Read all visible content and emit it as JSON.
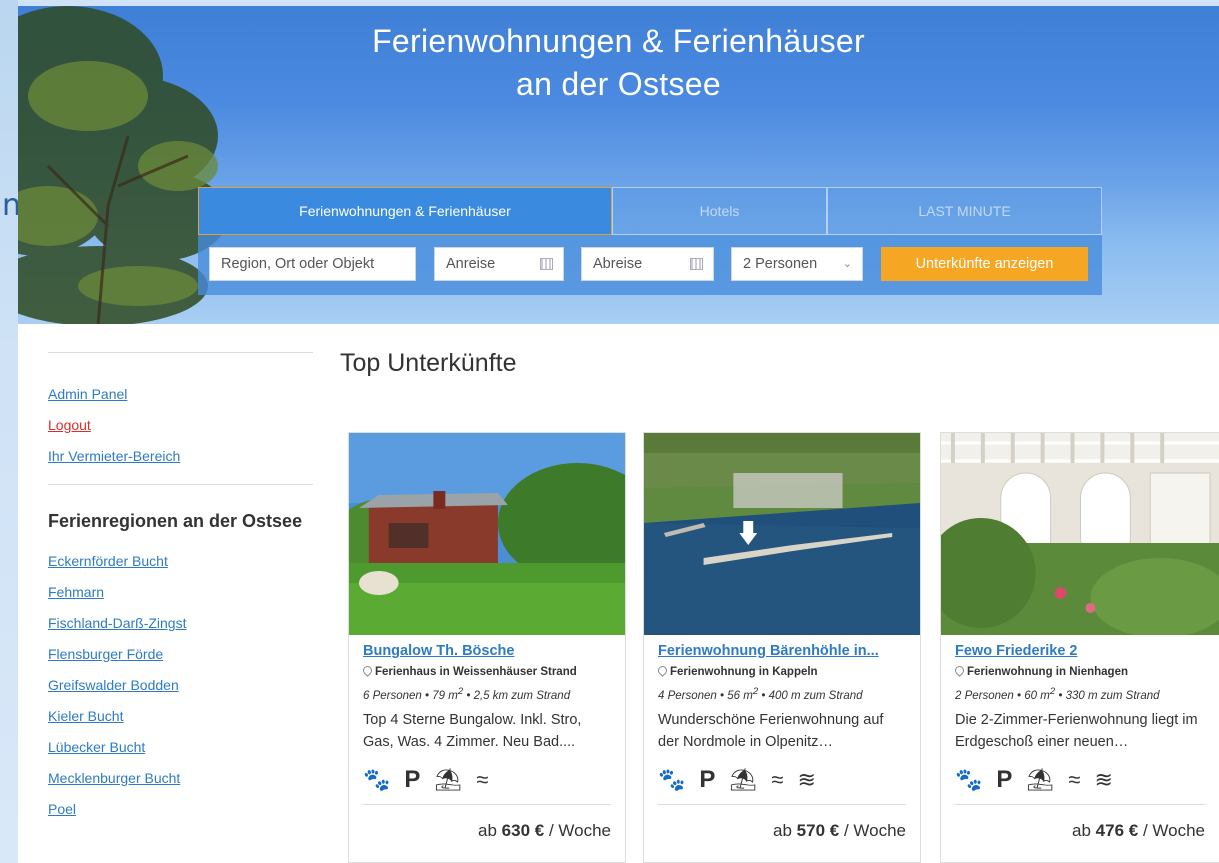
{
  "hero": {
    "title_line1": "Ferienwohnungen & Ferienhäuser",
    "title_line2": "an der Ostsee"
  },
  "search": {
    "tabs": [
      {
        "label": "Ferienwohnungen & Ferienhäuser",
        "active": true
      },
      {
        "label": "Hotels",
        "active": false
      },
      {
        "label": "LAST MINUTE",
        "active": false
      }
    ],
    "region_placeholder": "Region, Ort oder Objekt",
    "anreise_placeholder": "Anreise",
    "abreise_placeholder": "Abreise",
    "persons_value": "2 Personen",
    "submit_label": "Unterkünfte anzeigen"
  },
  "sidebar": {
    "links": [
      "Admin Panel",
      "Logout",
      "Ihr Vermieter-Bereich"
    ],
    "regions_heading": "Ferienregionen an der Ostsee",
    "regions": [
      "Eckernförder Bucht",
      "Fehmarn",
      "Fischland-Darß-Zingst",
      "Flensburger Förde",
      "Greifswalder Bodden",
      "Kieler Bucht",
      "Lübecker Bucht",
      "Mecklenburger Bucht",
      "Poel"
    ]
  },
  "main": {
    "title": "Top Unterkünfte",
    "cards": [
      {
        "name": "Bungalow Th. Bösche",
        "location": "Ferienhaus in Weissenhäuser Strand",
        "persons": "6 Personen",
        "area": "79",
        "distance": "2,5 km zum Strand",
        "description": "Top 4 Sterne Bungalow. Inkl. Stro, Gas, Was. 4 Zimmer. Neu Bad....",
        "amenities": [
          "paw-icon",
          "parking-icon",
          "beach-umbrella-icon",
          "wifi-icon"
        ],
        "price_prefix": "ab",
        "price": "630 €",
        "price_suffix": "/ Woche"
      },
      {
        "name": "Ferienwohnung Bärenhöhle in...",
        "location": "Ferienwohnung in Kappeln",
        "persons": "4 Personen",
        "area": "56",
        "distance": "400 m zum Strand",
        "description": "Wunderschöne Ferienwohnung auf der Nordmole in Olpenitz…",
        "amenities": [
          "paw-icon",
          "parking-icon",
          "beach-umbrella-icon",
          "wifi-icon",
          "swimming-icon"
        ],
        "price_prefix": "ab",
        "price": "570 €",
        "price_suffix": "/ Woche"
      },
      {
        "name": "Fewo Friederike 2",
        "location": "Ferienwohnung in Nienhagen",
        "persons": "2 Personen",
        "area": "60",
        "distance": "330 m zum Strand",
        "description": "Die 2-Zimmer-Ferienwohnung liegt im Erdgeschoß einer neuen…",
        "amenities": [
          "paw-icon",
          "parking-icon",
          "beach-umbrella-icon",
          "wifi-icon",
          "swimming-icon"
        ],
        "price_prefix": "ab",
        "price": "476 €",
        "price_suffix": "/ Woche"
      }
    ]
  },
  "colors": {
    "link": "#2e7bc4",
    "logout": "#d9302c",
    "accent_button": "#f5a623",
    "active_tab": "#3a8be0"
  }
}
